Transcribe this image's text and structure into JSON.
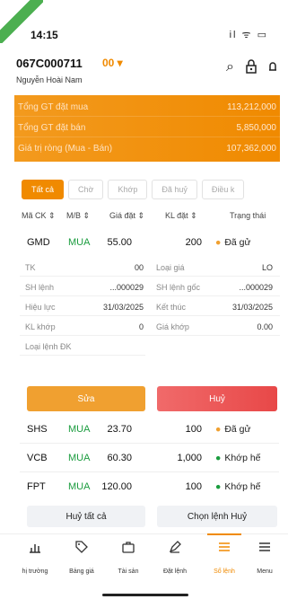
{
  "status_bar": {
    "time": "14:15",
    "icons": "il ᯤ ▭"
  },
  "account": {
    "id": "067C000711",
    "sub_account": "00 ▾",
    "name": "Nguyễn Hoài Nam"
  },
  "header_icons": {
    "search": "⌕",
    "lock": "🔒",
    "bell": "🔔"
  },
  "summary": {
    "buy_label": "Tổng GT đặt mua",
    "buy_value": "113,212,000",
    "sell_label": "Tổng GT đặt bán",
    "sell_value": "5,850,000",
    "net_label": "Giá trị ròng (Mua - Bán)",
    "net_value": "107,362,000"
  },
  "tabs": [
    "Tất cả",
    "Chờ",
    "Khớp",
    "Đã huỷ",
    "Điều k"
  ],
  "columns": {
    "symbol": "Mã CK ⇕",
    "side": "M/B ⇕",
    "price": "Giá đặt ⇕",
    "qty": "KL đặt ⇕",
    "status": "Trạng thái"
  },
  "orders": [
    {
      "symbol": "GMD",
      "side": "MUA",
      "price": "55.00",
      "qty": "200",
      "status": "Đã gử",
      "status_color": "#f0a030"
    },
    {
      "symbol": "SHS",
      "side": "MUA",
      "price": "23.70",
      "qty": "100",
      "status": "Đã gử",
      "status_color": "#f0a030"
    },
    {
      "symbol": "VCB",
      "side": "MUA",
      "price": "60.30",
      "qty": "1,000",
      "status": "Khớp hế",
      "status_color": "#1a9c3e"
    },
    {
      "symbol": "FPT",
      "side": "MUA",
      "price": "120.00",
      "qty": "100",
      "status": "Khớp hế",
      "status_color": "#1a9c3e"
    }
  ],
  "detail": {
    "account_label": "TK",
    "account_value": "00",
    "price_type_label": "Loại giá",
    "price_type_value": "LO",
    "order_no_label": "SH lệnh",
    "order_no_value": "...000029",
    "orig_order_label": "SH lệnh gốc",
    "orig_order_value": "...000029",
    "valid_label": "Hiệu lực",
    "valid_value": "31/03/2025",
    "end_label": "Kết thúc",
    "end_value": "31/03/2025",
    "matched_qty_label": "KL khớp",
    "matched_qty_value": "0",
    "matched_price_label": "Giá khớp",
    "matched_price_value": "0.00",
    "cond_type_label": "Loại lệnh ĐK"
  },
  "actions": {
    "edit": "Sửa",
    "cancel": "Huỷ"
  },
  "bottom_actions": {
    "cancel_all": "Huỷ tất cả",
    "select_cancel": "Chọn lệnh Huỷ"
  },
  "nav": [
    {
      "label": "hị trường",
      "icon": "📈"
    },
    {
      "label": "Bảng giá",
      "icon": "🏷"
    },
    {
      "label": "Tài sản",
      "icon": "💼"
    },
    {
      "label": "Đặt lệnh",
      "icon": "✎"
    },
    {
      "label": "Sổ lệnh",
      "icon": "☰",
      "active": true
    },
    {
      "label": "Menu",
      "icon": "≡"
    }
  ],
  "colors": {
    "accent": "#f08a00",
    "buy": "#1a9c3e",
    "cancel": "#e84848"
  }
}
